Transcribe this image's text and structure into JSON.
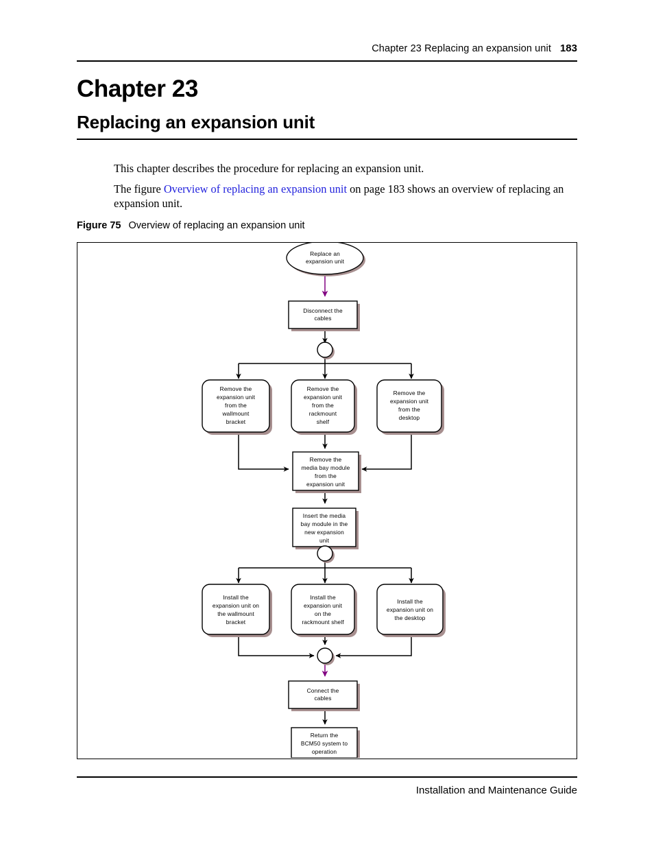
{
  "header": {
    "text": "Chapter 23  Replacing an expansion unit",
    "page_number": "183"
  },
  "chapter": {
    "number": "Chapter 23",
    "title": "Replacing an expansion unit"
  },
  "body": {
    "paragraph_1": "This chapter describes the procedure for replacing an expansion unit.",
    "paragraph_2_before": "The figure ",
    "paragraph_2_link": "Overview of replacing an expansion unit",
    "paragraph_2_after": " on page 183 shows an overview of replacing an expansion unit."
  },
  "figure": {
    "label": "Figure 75",
    "caption": "Overview of replacing an expansion unit"
  },
  "footer": {
    "text": "Installation and Maintenance Guide"
  },
  "colors": {
    "link": "#2222dd",
    "arrow_purple": "#800080",
    "arrow_black": "#000000",
    "node_shadow": "#a78f8f",
    "node_fill": "#ffffff",
    "node_stroke": "#000000"
  },
  "chart_data": {
    "type": "diagram",
    "title": "Overview of replacing an expansion unit",
    "diagram_kind": "flowchart",
    "nodes": [
      {
        "id": "start",
        "shape": "ellipse",
        "lines": [
          "Replace an",
          "expansion unit"
        ]
      },
      {
        "id": "disconnect",
        "shape": "rect",
        "lines": [
          "Disconnect the",
          "cables"
        ]
      },
      {
        "id": "fork1",
        "shape": "circle",
        "lines": []
      },
      {
        "id": "remove_wallmount",
        "shape": "rounded-rect",
        "lines": [
          "Remove the",
          "expansion unit",
          "from the",
          "wallmount",
          "bracket"
        ]
      },
      {
        "id": "remove_rackmount",
        "shape": "rounded-rect",
        "lines": [
          "Remove the",
          "expansion unit",
          "from the",
          "rackmount",
          "shelf"
        ]
      },
      {
        "id": "remove_desktop",
        "shape": "rounded-rect",
        "lines": [
          "Remove the",
          "expansion unit",
          "from the",
          "desktop"
        ]
      },
      {
        "id": "remove_media_bay",
        "shape": "rect",
        "lines": [
          "Remove the",
          "media bay module",
          "from the",
          "expansion unit"
        ]
      },
      {
        "id": "insert_media_bay",
        "shape": "rect",
        "lines": [
          "Insert the media",
          "bay module in the",
          "new expansion",
          "unit"
        ]
      },
      {
        "id": "fork2",
        "shape": "circle",
        "lines": []
      },
      {
        "id": "install_wallmount",
        "shape": "rounded-rect",
        "lines": [
          "Install the",
          "expansion unit on",
          "the wallmount",
          "bracket"
        ]
      },
      {
        "id": "install_rackmount",
        "shape": "rounded-rect",
        "lines": [
          "Install the",
          "expansion unit",
          "on the",
          "rackmount shelf"
        ]
      },
      {
        "id": "install_desktop",
        "shape": "rounded-rect",
        "lines": [
          "Install the",
          "expansion unit on",
          "the desktop"
        ]
      },
      {
        "id": "merge",
        "shape": "circle",
        "lines": []
      },
      {
        "id": "connect",
        "shape": "rect",
        "lines": [
          "Connect the",
          "cables"
        ]
      },
      {
        "id": "return",
        "shape": "rect",
        "lines": [
          "Return the",
          "BCM50 system to",
          "operation"
        ]
      }
    ],
    "edges": [
      {
        "from": "start",
        "to": "disconnect",
        "color": "purple"
      },
      {
        "from": "disconnect",
        "to": "fork1",
        "color": "black"
      },
      {
        "from": "fork1",
        "to": "remove_wallmount",
        "color": "black"
      },
      {
        "from": "fork1",
        "to": "remove_rackmount",
        "color": "black"
      },
      {
        "from": "fork1",
        "to": "remove_desktop",
        "color": "black"
      },
      {
        "from": "remove_wallmount",
        "to": "remove_media_bay",
        "color": "black"
      },
      {
        "from": "remove_rackmount",
        "to": "remove_media_bay",
        "color": "black"
      },
      {
        "from": "remove_desktop",
        "to": "remove_media_bay",
        "color": "black"
      },
      {
        "from": "remove_media_bay",
        "to": "insert_media_bay",
        "color": "black"
      },
      {
        "from": "insert_media_bay",
        "to": "fork2",
        "color": "black"
      },
      {
        "from": "fork2",
        "to": "install_wallmount",
        "color": "black"
      },
      {
        "from": "fork2",
        "to": "install_rackmount",
        "color": "black"
      },
      {
        "from": "fork2",
        "to": "install_desktop",
        "color": "black"
      },
      {
        "from": "install_wallmount",
        "to": "merge",
        "color": "black"
      },
      {
        "from": "install_rackmount",
        "to": "merge",
        "color": "black"
      },
      {
        "from": "install_desktop",
        "to": "merge",
        "color": "black"
      },
      {
        "from": "merge",
        "to": "connect",
        "color": "purple"
      },
      {
        "from": "connect",
        "to": "return",
        "color": "black"
      }
    ]
  }
}
